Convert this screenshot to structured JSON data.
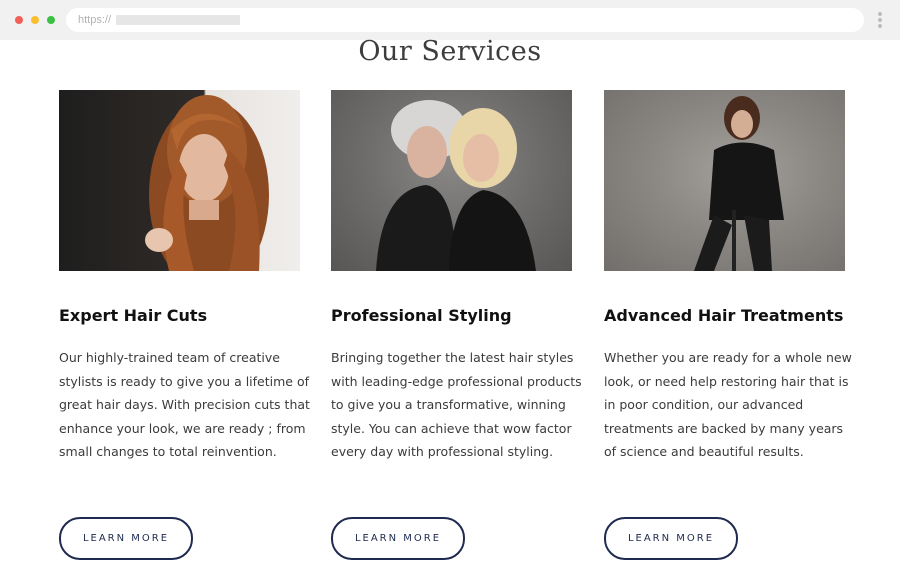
{
  "browser": {
    "url_prefix": "https://",
    "icons": {
      "menu": "vertical-ellipsis-icon"
    },
    "colors": {
      "close": "#f25f58",
      "minimize": "#f9be2e",
      "maximize": "#3ac143"
    }
  },
  "page": {
    "title": "Our Services",
    "accent_color": "#1e2a4f"
  },
  "services": [
    {
      "title": "Expert Hair Cuts",
      "description": "Our highly-trained team of creative stylists is ready to give you a lifetime of great hair days. With precision cuts that enhance your look, we are ready ; from small changes to total reinvention.",
      "button_label": "LEARN MORE",
      "image": "woman-with-long-wavy-hair-photo"
    },
    {
      "title": "Professional Styling",
      "description": "Bringing together the latest hair styles with leading-edge professional products to give you a transformative, winning style. You can achieve that wow factor every day with professional styling.",
      "button_label": "LEARN MORE",
      "image": "two-smiling-women-photo"
    },
    {
      "title": "Advanced Hair Treatments",
      "description": "Whether you are ready for a whole new look, or need help restoring hair that is in poor condition, our advanced treatments are backed by many years of science and beautiful results.",
      "button_label": "LEARN MORE",
      "image": "seated-man-in-black-suit-photo"
    }
  ]
}
